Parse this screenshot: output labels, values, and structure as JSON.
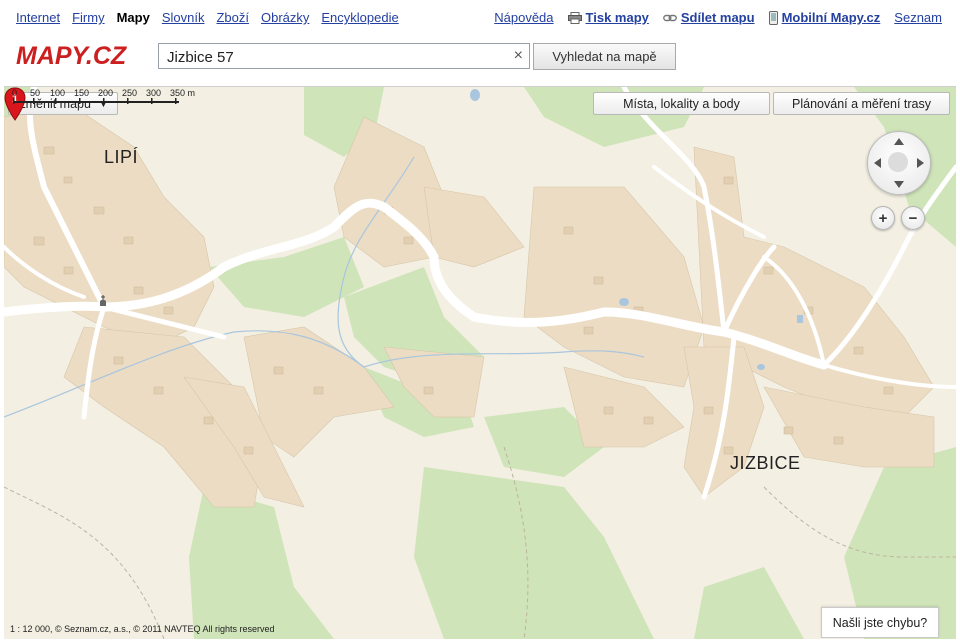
{
  "topnav": {
    "left": [
      {
        "label": "Internet",
        "active": false
      },
      {
        "label": "Firmy",
        "active": false
      },
      {
        "label": "Mapy",
        "active": true
      },
      {
        "label": "Slovník",
        "active": false
      },
      {
        "label": "Zboží",
        "active": false
      },
      {
        "label": "Obrázky",
        "active": false
      },
      {
        "label": "Encyklopedie",
        "active": false
      }
    ],
    "help_label": "Nápověda",
    "print_label": "Tisk mapy",
    "share_label": "Sdílet mapu",
    "mobile_label": "Mobilní Mapy.cz",
    "seznam_label": "Seznam"
  },
  "logo": {
    "text": "MAPY.CZ",
    "color": "#cc1f1f"
  },
  "search": {
    "value": "Jizbice 57",
    "clear_icon": "×",
    "button_label": "Vyhledat na mapě"
  },
  "map": {
    "change_map_label": "Změnit mapu",
    "change_map_arrow": "▼",
    "places_label": "Místa, lokality a body",
    "planning_label": "Plánování a měření trasy",
    "labels": {
      "lipi": "LIPÍ",
      "jizbice": "JIZBICE"
    },
    "pin_number": "1",
    "zoom_in": "+",
    "zoom_out": "−",
    "scale_ticks": [
      "0",
      "50",
      "100",
      "150",
      "200",
      "250",
      "300",
      "350 m"
    ],
    "copyright": "1 : 12 000, © Seznam.cz, a.s., © 2011 NAVTEQ All rights reserved",
    "error_label": "Našli jste chybu?",
    "colors": {
      "background": "#f3efe2",
      "forest": "#cfe4b9",
      "village": "#ecdcc3",
      "road": "#ffffff",
      "water": "#a9c6de",
      "pin": "#d8161c"
    }
  }
}
